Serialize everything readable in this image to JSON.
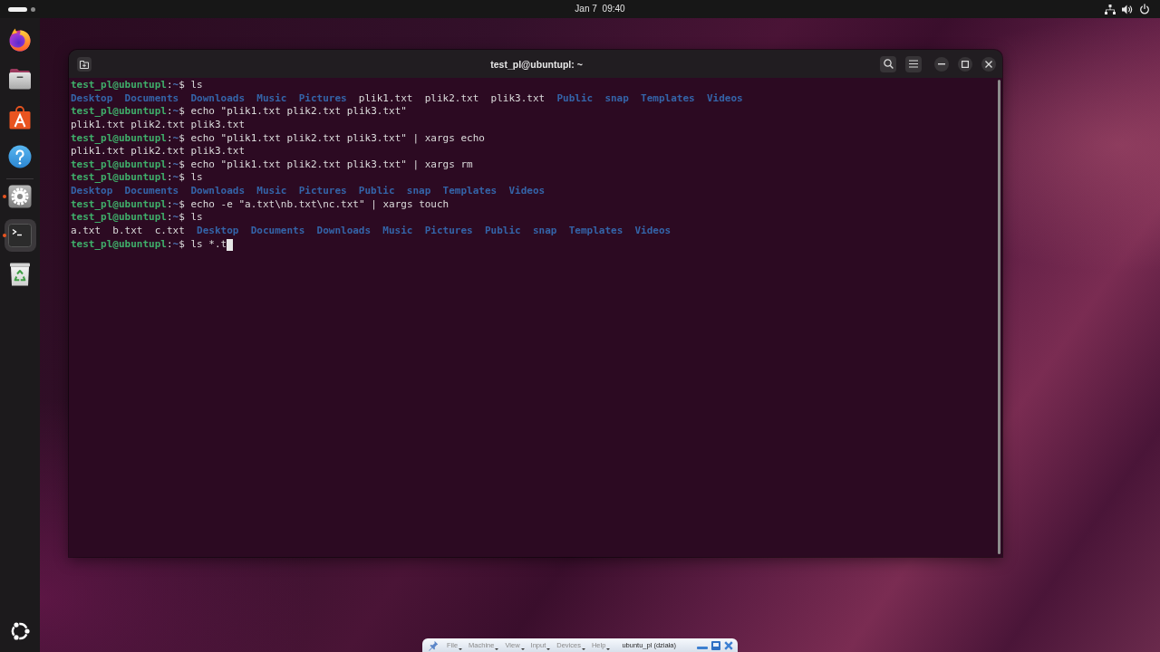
{
  "top_bar": {
    "workspaces": [
      {
        "selected": true
      },
      {
        "selected": false
      }
    ],
    "date": "Jan 7",
    "time": "09:40"
  },
  "dock": {
    "sections": [
      {
        "items": [
          {
            "kind": "browser",
            "running": false,
            "focused": false
          },
          {
            "kind": "files",
            "running": false,
            "focused": false
          },
          {
            "kind": "store",
            "running": false,
            "focused": false
          },
          {
            "kind": "help",
            "running": false,
            "focused": false
          }
        ]
      },
      {
        "items": [
          {
            "kind": "settings",
            "running": true,
            "focused": false
          },
          {
            "kind": "terminal",
            "running": true,
            "focused": true
          },
          {
            "kind": "trash",
            "running": false,
            "focused": false
          }
        ]
      }
    ]
  },
  "terminal": {
    "title": "test_pl@ubuntupl: ~",
    "lines": [
      {
        "kind": "prompt",
        "user_host": "test_pl@ubuntupl",
        "separator": ":",
        "path": "~",
        "symbol": "$",
        "command": "ls",
        "cursor": false
      },
      {
        "kind": "listing",
        "entries": [
          {
            "text": "Desktop",
            "kind": "directory"
          },
          {
            "text": "Documents",
            "kind": "directory"
          },
          {
            "text": "Downloads",
            "kind": "directory"
          },
          {
            "text": "Music",
            "kind": "directory"
          },
          {
            "text": "Pictures",
            "kind": "directory"
          },
          {
            "text": "plik1.txt",
            "kind": "file"
          },
          {
            "text": "plik2.txt",
            "kind": "file"
          },
          {
            "text": "plik3.txt",
            "kind": "file"
          },
          {
            "text": "Public",
            "kind": "directory"
          },
          {
            "text": "snap",
            "kind": "directory"
          },
          {
            "text": "Templates",
            "kind": "directory"
          },
          {
            "text": "Videos",
            "kind": "directory"
          }
        ]
      },
      {
        "kind": "prompt",
        "user_host": "test_pl@ubuntupl",
        "separator": ":",
        "path": "~",
        "symbol": "$",
        "command": "echo \"plik1.txt plik2.txt plik3.txt\"",
        "cursor": false
      },
      {
        "kind": "output",
        "text": "plik1.txt plik2.txt plik3.txt"
      },
      {
        "kind": "prompt",
        "user_host": "test_pl@ubuntupl",
        "separator": ":",
        "path": "~",
        "symbol": "$",
        "command": "echo \"plik1.txt plik2.txt plik3.txt\" | xargs echo",
        "cursor": false
      },
      {
        "kind": "output",
        "text": "plik1.txt plik2.txt plik3.txt"
      },
      {
        "kind": "prompt",
        "user_host": "test_pl@ubuntupl",
        "separator": ":",
        "path": "~",
        "symbol": "$",
        "command": "echo \"plik1.txt plik2.txt plik3.txt\" | xargs rm",
        "cursor": false
      },
      {
        "kind": "prompt",
        "user_host": "test_pl@ubuntupl",
        "separator": ":",
        "path": "~",
        "symbol": "$",
        "command": "ls",
        "cursor": false
      },
      {
        "kind": "listing",
        "entries": [
          {
            "text": "Desktop",
            "kind": "directory"
          },
          {
            "text": "Documents",
            "kind": "directory"
          },
          {
            "text": "Downloads",
            "kind": "directory"
          },
          {
            "text": "Music",
            "kind": "directory"
          },
          {
            "text": "Pictures",
            "kind": "directory"
          },
          {
            "text": "Public",
            "kind": "directory"
          },
          {
            "text": "snap",
            "kind": "directory"
          },
          {
            "text": "Templates",
            "kind": "directory"
          },
          {
            "text": "Videos",
            "kind": "directory"
          }
        ]
      },
      {
        "kind": "prompt",
        "user_host": "test_pl@ubuntupl",
        "separator": ":",
        "path": "~",
        "symbol": "$",
        "command": "echo -e \"a.txt\\nb.txt\\nc.txt\" | xargs touch",
        "cursor": false
      },
      {
        "kind": "prompt",
        "user_host": "test_pl@ubuntupl",
        "separator": ":",
        "path": "~",
        "symbol": "$",
        "command": "ls",
        "cursor": false
      },
      {
        "kind": "listing",
        "entries": [
          {
            "text": "a.txt",
            "kind": "file"
          },
          {
            "text": "b.txt",
            "kind": "file"
          },
          {
            "text": "c.txt",
            "kind": "file"
          },
          {
            "text": "Desktop",
            "kind": "directory"
          },
          {
            "text": "Documents",
            "kind": "directory"
          },
          {
            "text": "Downloads",
            "kind": "directory"
          },
          {
            "text": "Music",
            "kind": "directory"
          },
          {
            "text": "Pictures",
            "kind": "directory"
          },
          {
            "text": "Public",
            "kind": "directory"
          },
          {
            "text": "snap",
            "kind": "directory"
          },
          {
            "text": "Templates",
            "kind": "directory"
          },
          {
            "text": "Videos",
            "kind": "directory"
          }
        ]
      },
      {
        "kind": "prompt",
        "user_host": "test_pl@ubuntupl",
        "separator": ":",
        "path": "~",
        "symbol": "$",
        "command": "ls *.t",
        "cursor": true
      }
    ]
  },
  "vm_toolbar": {
    "menus": [
      "File",
      "Machine",
      "View",
      "Input",
      "Devices",
      "Help"
    ],
    "status": "ubuntu_pl (działa)"
  }
}
